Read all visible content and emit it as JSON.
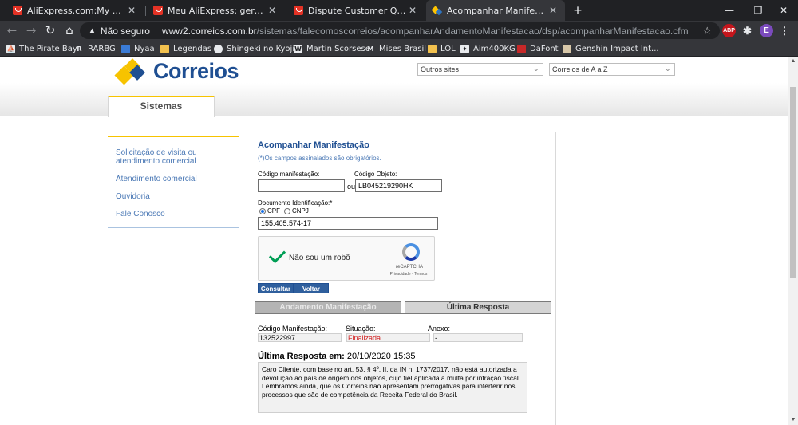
{
  "browser": {
    "tabs": [
      {
        "title": "AliExpress.com:My AliExpress"
      },
      {
        "title": "Meu AliExpress: gerenciar pedidos"
      },
      {
        "title": "Dispute Customer Questionnaire"
      },
      {
        "title": "Acompanhar Manifestacao"
      }
    ],
    "security_label": "Não seguro",
    "url_host": "www2.correios.com.br",
    "url_path": "/sistemas/falecomoscorreios/acompanharAndamentoManifestacao/dsp/acompanharManifestacao.cfm",
    "profile_initial": "E",
    "abp_label": "ABP",
    "bookmarks": [
      "The Pirate Bay",
      "RARBG",
      "Nyaa",
      "Legendas",
      "Shingeki no Kyojin",
      "Martin Scorsese",
      "Mises Brasil",
      "LOL",
      "Aim400KG",
      "DaFont",
      "Genshin Impact Int..."
    ]
  },
  "site": {
    "logo_text": "Correios",
    "select_sites": "Outros sites",
    "select_az": "Correios de A a Z",
    "systems_tab": "Sistemas"
  },
  "sidebar": {
    "items": [
      "Solicitação de visita ou atendimento comercial",
      "Atendimento comercial",
      "Ouvidoria",
      "Fale Conosco"
    ]
  },
  "form": {
    "title": "Acompanhar Manifestação",
    "required_note": "(*)Os campos assinalados são obrigatórios.",
    "codigo_manifestacao_label": "Código manifestação:",
    "codigo_manifestacao_value": "",
    "ou_label": "ou",
    "codigo_objeto_label": "Código Objeto:",
    "codigo_objeto_value": "LB045219290HK",
    "documento_label": "Documento Identificação:*",
    "radio_cpf": "CPF",
    "radio_cnpj": "CNPJ",
    "documento_value": "155.405.574-17",
    "captcha_text": "Não sou um robô",
    "captcha_brand": "reCAPTCHA",
    "captcha_terms": "Privacidade - Termos",
    "btn_consultar": "Consultar",
    "btn_voltar": "Voltar"
  },
  "result": {
    "tab_andamento": "Andamento Manifestação",
    "tab_ultima": "Última Resposta",
    "codigo_label": "Código Manifestação:",
    "codigo_value": "132522997",
    "situacao_label": "Situação:",
    "situacao_value": "Finalizada",
    "anexo_label": "Anexo:",
    "anexo_value": "-",
    "ultima_resposta_label": "Última Resposta em:",
    "ultima_resposta_date": "20/10/2020 15:35",
    "response_text": "Caro Cliente, com base no  art. 53, § 4º, II, da IN n. 1737/2017, não está autorizada a devolução ao país de origem dos objetos, cujo fiel aplicada a multa por infração fiscal Lembramos ainda, que os Correios não apresentam prerrogativas para interferir nos processos que são de competência da Receita Federal do Brasil."
  },
  "colors": {
    "correios_blue": "#1f4f92",
    "correios_yellow": "#f7c300",
    "link_blue": "#4a78b5",
    "status_red": "#d22222"
  }
}
